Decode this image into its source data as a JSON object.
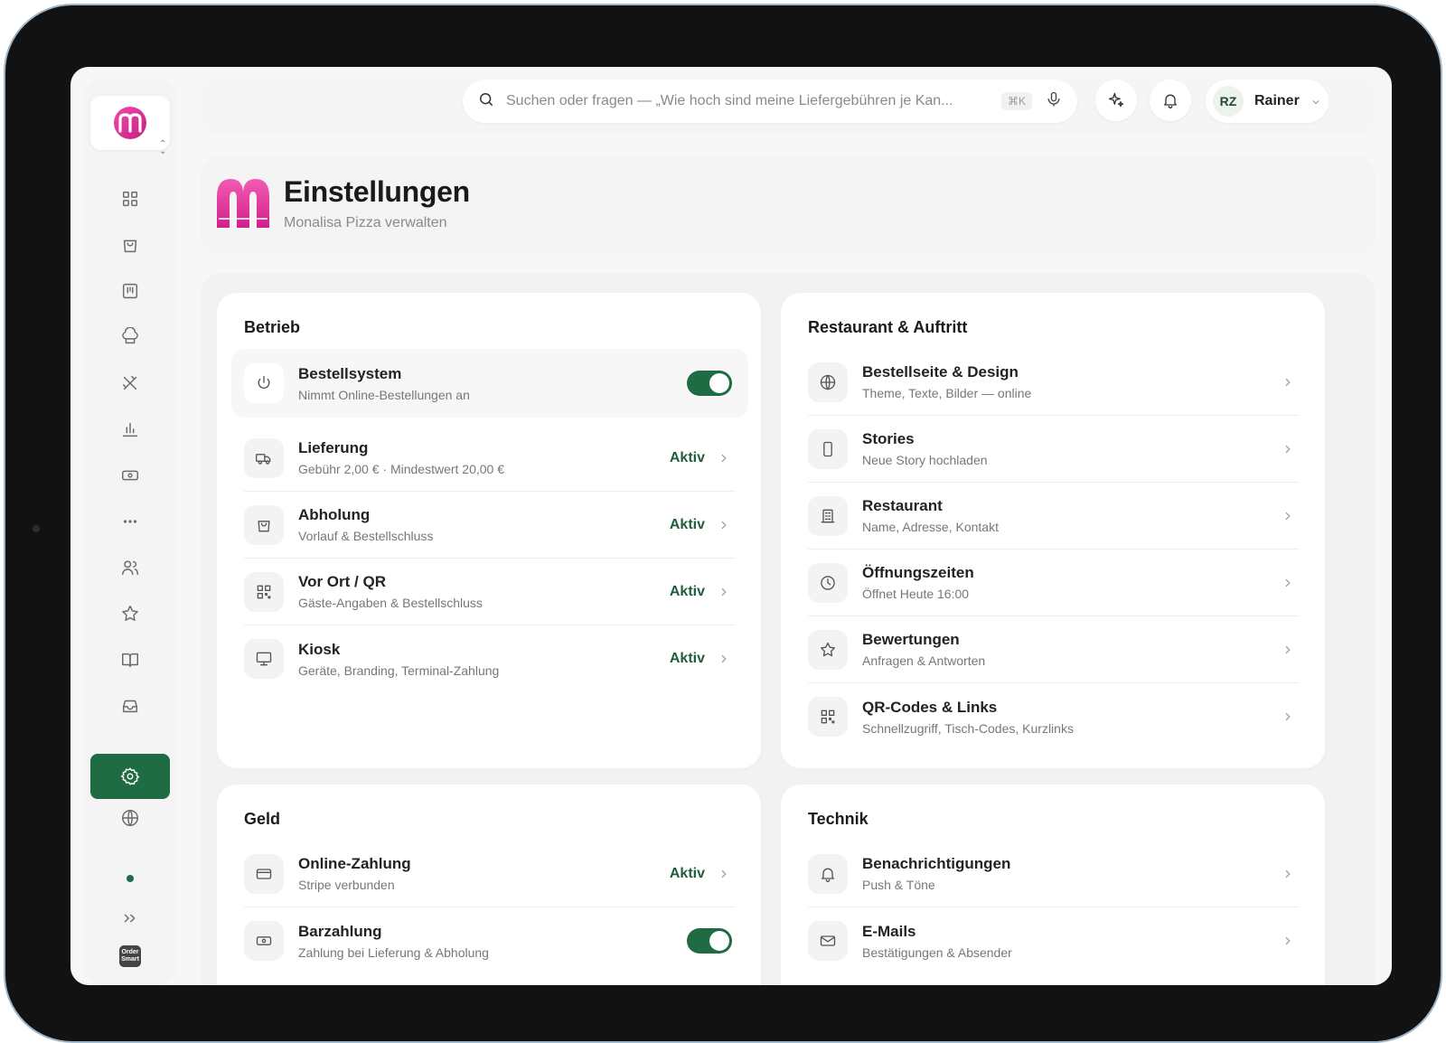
{
  "search": {
    "placeholder": "Suchen oder fragen — „Wie hoch sind meine Liefergebühren je Kan...",
    "shortcut": "⌘K"
  },
  "user": {
    "initials": "RZ",
    "name": "Rainer"
  },
  "page": {
    "title": "Einstellungen",
    "subtitle": "Monalisa Pizza verwalten"
  },
  "sidebar": {
    "items": [
      {
        "icon": "grid-icon"
      },
      {
        "icon": "shopping-bag-icon"
      },
      {
        "icon": "menu-board-icon"
      },
      {
        "icon": "chef-hat-icon"
      },
      {
        "icon": "utensils-icon"
      },
      {
        "icon": "bar-chart-icon"
      },
      {
        "icon": "cash-icon"
      },
      {
        "icon": "more-icon"
      },
      {
        "icon": "users-icon"
      },
      {
        "icon": "star-icon"
      },
      {
        "icon": "book-icon"
      },
      {
        "icon": "inbox-icon"
      },
      {
        "icon": "gear-icon",
        "active": true
      },
      {
        "icon": "globe-icon"
      },
      {
        "icon": "chevrons-right-icon"
      }
    ],
    "bottom_logo": "Order Smart"
  },
  "betrieb": {
    "title": "Betrieb",
    "rows": [
      {
        "title": "Bestellsystem",
        "sub": "Nimmt Online-Bestellungen an",
        "control": "toggle",
        "icon": "power-icon"
      },
      {
        "title": "Lieferung",
        "sub": "Gebühr 2,00 € · Mindestwert 20,00 €",
        "status": "Aktiv",
        "icon": "truck-icon"
      },
      {
        "title": "Abholung",
        "sub": "Vorlauf & Bestellschluss",
        "status": "Aktiv",
        "icon": "bag-icon"
      },
      {
        "title": "Vor Ort / QR",
        "sub": "Gäste-Angaben & Bestellschluss",
        "status": "Aktiv",
        "icon": "qr-icon"
      },
      {
        "title": "Kiosk",
        "sub": "Geräte, Branding, Terminal-Zahlung",
        "status": "Aktiv",
        "icon": "monitor-icon"
      }
    ]
  },
  "restaurant": {
    "title": "Restaurant & Auftritt",
    "rows": [
      {
        "title": "Bestellseite & Design",
        "sub": "Theme, Texte, Bilder — online",
        "icon": "globe-icon"
      },
      {
        "title": "Stories",
        "sub": "Neue Story hochladen",
        "icon": "phone-icon"
      },
      {
        "title": "Restaurant",
        "sub": "Name, Adresse, Kontakt",
        "icon": "building-icon"
      },
      {
        "title": "Öffnungszeiten",
        "sub": "Öffnet Heute 16:00",
        "icon": "clock-icon"
      },
      {
        "title": "Bewertungen",
        "sub": "Anfragen & Antworten",
        "icon": "star-icon"
      },
      {
        "title": "QR-Codes & Links",
        "sub": "Schnellzugriff, Tisch-Codes, Kurzlinks",
        "icon": "qr-icon"
      }
    ]
  },
  "geld": {
    "title": "Geld",
    "rows": [
      {
        "title": "Online-Zahlung",
        "sub": "Stripe verbunden",
        "status": "Aktiv",
        "icon": "credit-card-icon"
      },
      {
        "title": "Barzahlung",
        "sub": "Zahlung bei Lieferung & Abholung",
        "control": "toggle",
        "icon": "cash-icon"
      }
    ]
  },
  "technik": {
    "title": "Technik",
    "rows": [
      {
        "title": "Benachrichtigungen",
        "sub": "Push & Töne",
        "icon": "bell-icon"
      },
      {
        "title": "E-Mails",
        "sub": "Bestätigungen & Absender",
        "icon": "mail-icon"
      }
    ]
  },
  "colors": {
    "accent": "#1f6b43",
    "brand": "#e0329a",
    "status": "#1f5d3c"
  }
}
